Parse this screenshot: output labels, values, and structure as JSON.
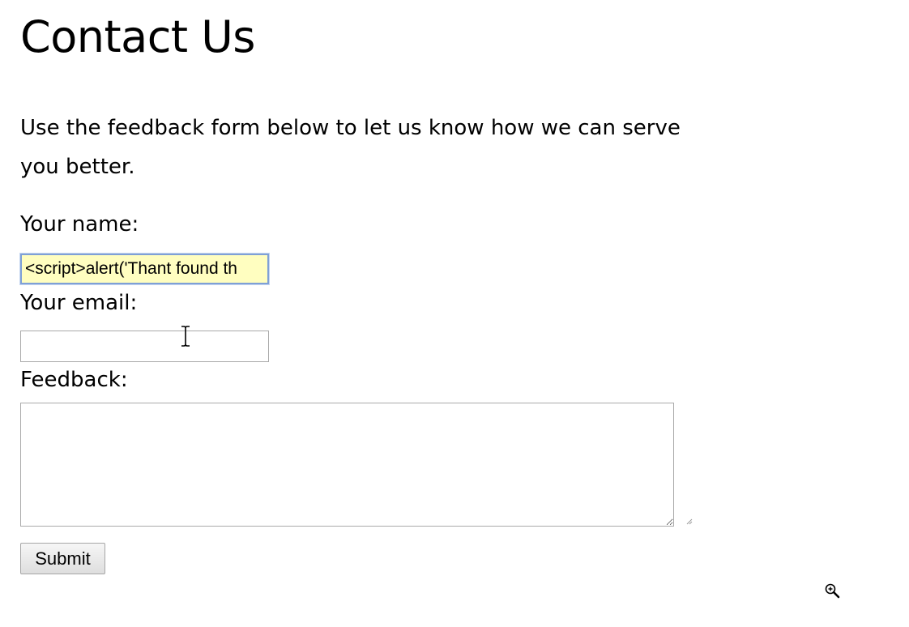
{
  "page": {
    "title": "Contact Us",
    "intro": "Use the feedback form below to let us know how we can serve you better."
  },
  "form": {
    "name_label": "Your name:",
    "name_value": "<script>alert('Thant found th",
    "email_label": "Your email:",
    "email_value": "",
    "feedback_label": "Feedback:",
    "feedback_value": "",
    "submit_label": "Submit"
  },
  "icons": {
    "cursor": "text-cursor-icon",
    "zoom": "zoom-in-icon"
  },
  "colors": {
    "autofill_bg": "#fffec0",
    "focus_border": "#7fa0d6"
  }
}
